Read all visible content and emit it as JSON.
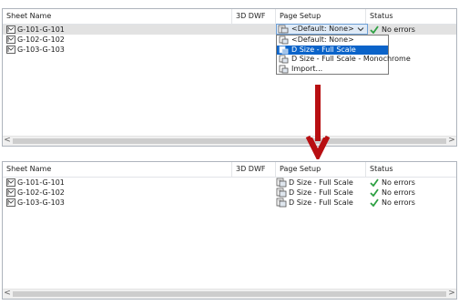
{
  "top_panel": {
    "columns": [
      "Sheet Name",
      "3D DWF",
      "Page Setup",
      "Status"
    ],
    "rows": [
      {
        "sheet": "G-101-G-101",
        "status": "No errors"
      },
      {
        "sheet": "G-102-G-102"
      },
      {
        "sheet": "G-103-G-103"
      }
    ],
    "combo_value": "<Default: None>",
    "dropdown_options": [
      "<Default: None>",
      "D Size - Full Scale",
      "D Size - Full Scale - Monochrome",
      "Import..."
    ],
    "highlighted_option_index": 1
  },
  "bottom_panel": {
    "columns": [
      "Sheet Name",
      "3D DWF",
      "Page Setup",
      "Status"
    ],
    "rows": [
      {
        "sheet": "G-101-G-101",
        "page_setup": "D Size - Full Scale",
        "status": "No errors"
      },
      {
        "sheet": "G-102-G-102",
        "page_setup": "D Size - Full Scale",
        "status": "No errors"
      },
      {
        "sheet": "G-103-G-103",
        "page_setup": "D Size - Full Scale",
        "status": "No errors"
      }
    ]
  },
  "scrollbar_arrows": {
    "left": "<",
    "right": ">"
  },
  "colors": {
    "arrow": "#b80f12",
    "check": "#2ea043",
    "highlight": "#0a63c9",
    "selected_row": "#e2e2e2"
  },
  "icons": {
    "sheet": "sheet-document-icon",
    "page_setup": "page-setup-icon",
    "status_ok": "check-icon",
    "dropdown": "chevron-down-icon",
    "transition": "down-arrow-icon"
  }
}
